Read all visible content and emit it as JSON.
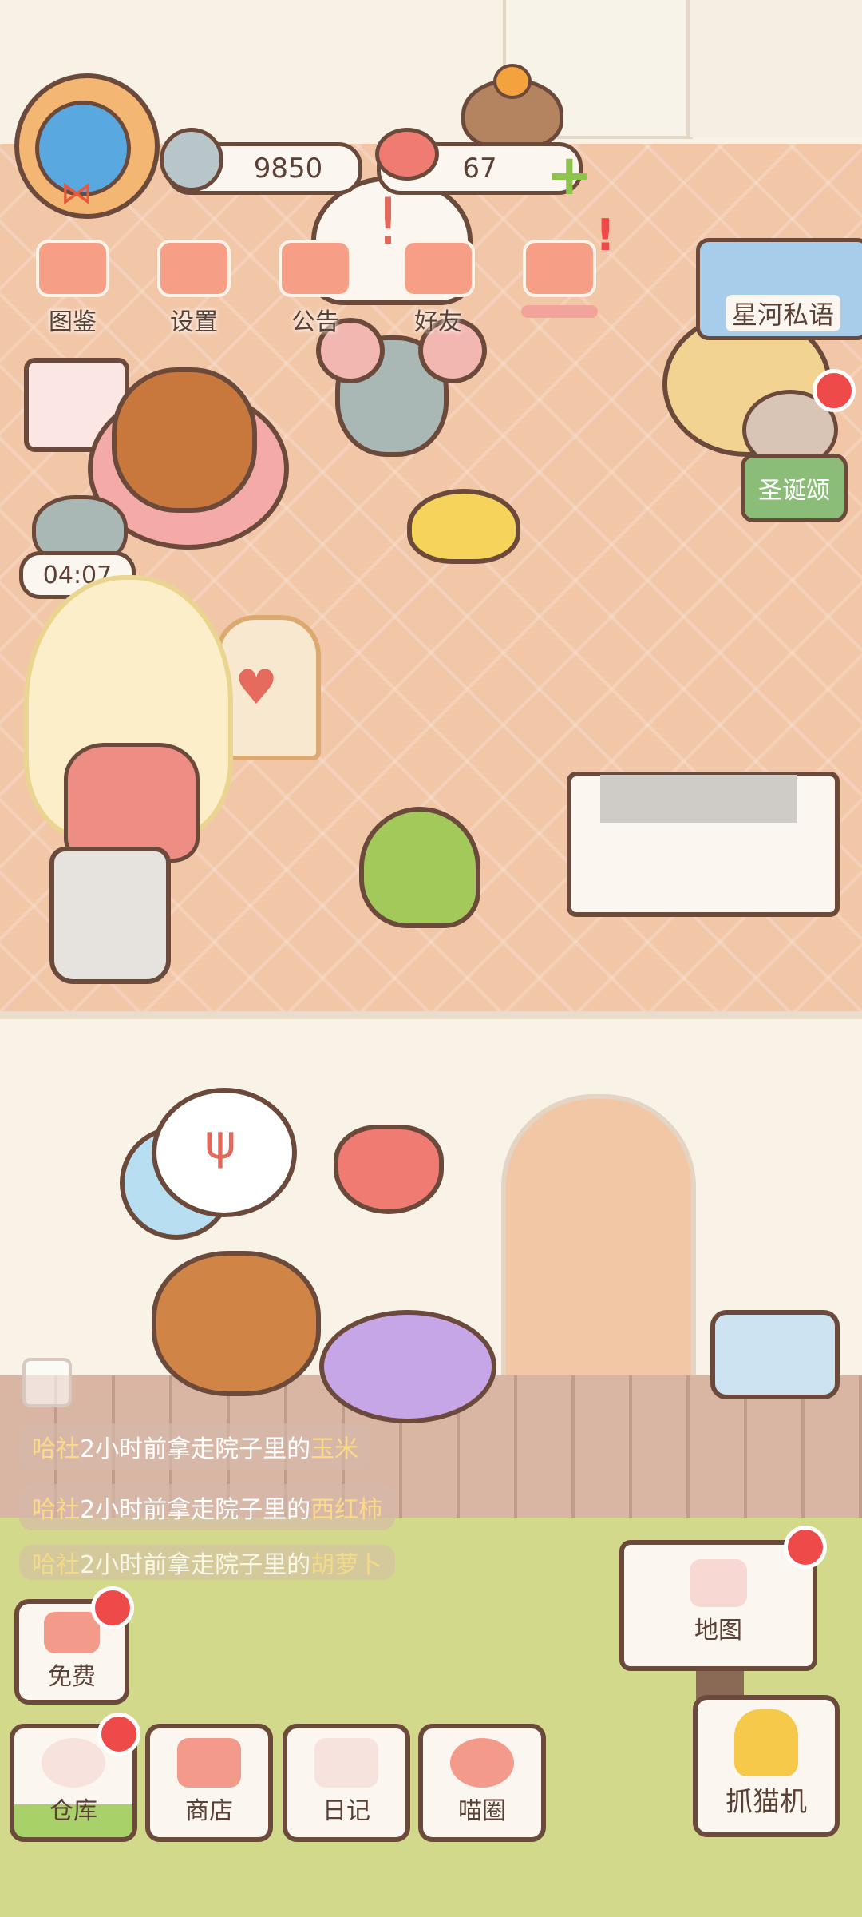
{
  "hud": {
    "fish_count": "9850",
    "heart_count": "67",
    "timer": "04:07"
  },
  "menu": [
    {
      "label": "图鉴",
      "icon": "cat-book-icon"
    },
    {
      "label": "设置",
      "icon": "gear-icon"
    },
    {
      "label": "公告",
      "icon": "gift-icon"
    },
    {
      "label": "好友",
      "icon": "friends-icon"
    },
    {
      "label": "",
      "icon": "heart-hands-icon"
    }
  ],
  "side": {
    "star_river": "星河私语",
    "christmas": "圣诞颂"
  },
  "notices": [
    {
      "name": "哈社",
      "time": "2小时前拿走院子里的",
      "item": "玉米"
    },
    {
      "name": "哈社",
      "time": "2小时前拿走院子里的",
      "item": "西红柿"
    },
    {
      "name": "哈社",
      "time": "2小时前拿走院子里的",
      "item": "胡萝卜"
    }
  ],
  "buttons": {
    "free": "免费",
    "warehouse": "仓库",
    "shop": "商店",
    "diary": "日记",
    "circle": "喵圈",
    "map": "地图",
    "claw": "抓猫机"
  },
  "colors": {
    "badge": "#ef4a4a",
    "outline": "#6b4a3b",
    "floor": "#f2c7a8",
    "grass": "#d3d98a"
  }
}
